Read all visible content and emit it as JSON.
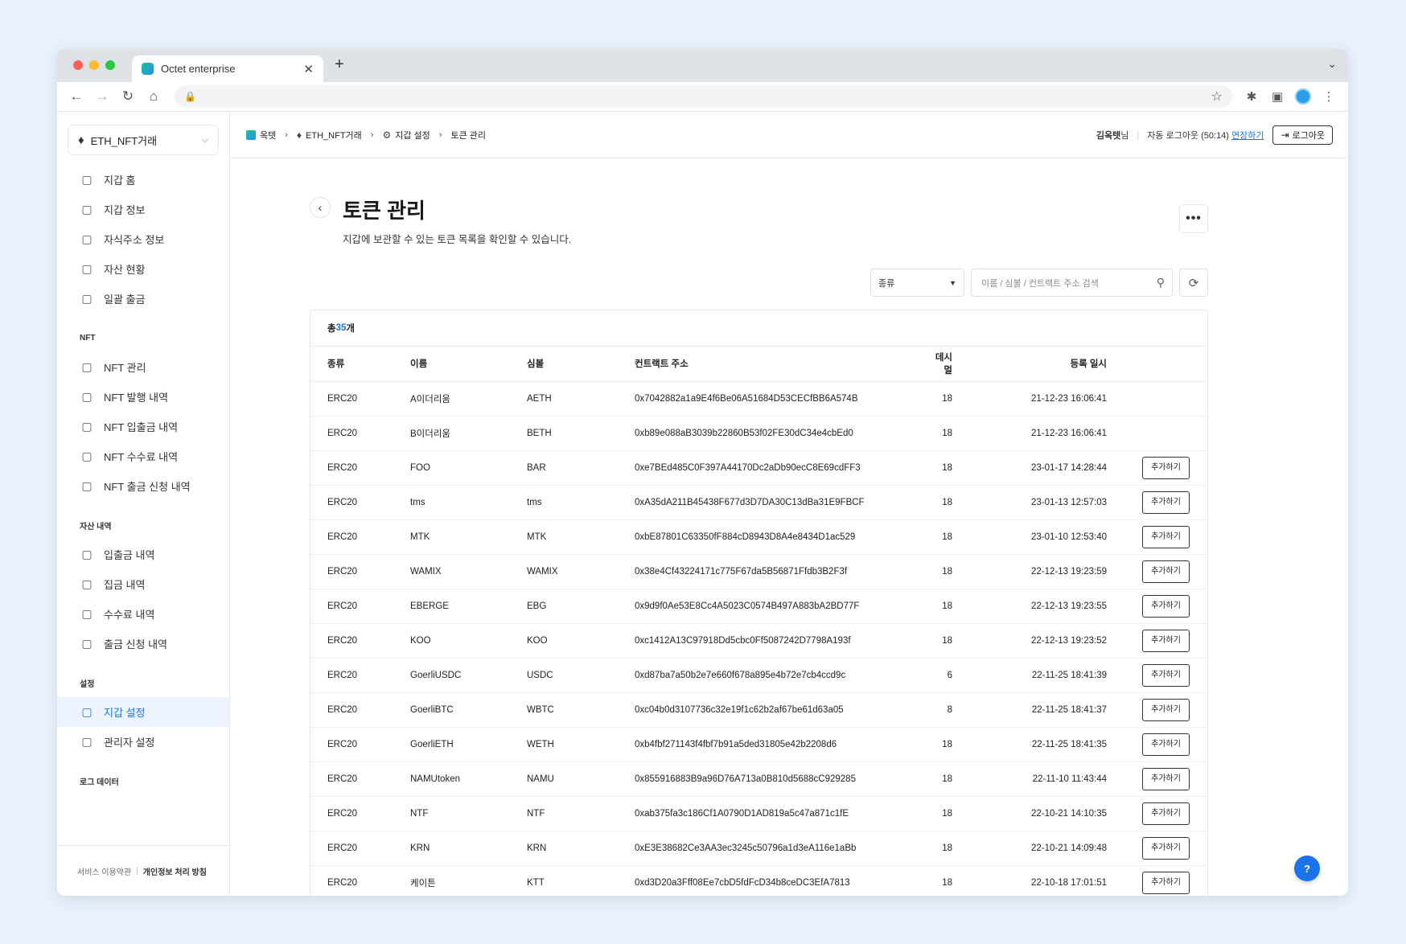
{
  "browser": {
    "tab_title": "Octet enterprise",
    "tab_close": "✕",
    "new_tab": "+"
  },
  "sidebar": {
    "wallet_selector": "ETH_NFT거래",
    "main_items": [
      {
        "label": "지갑 홈",
        "icon": "wallet-icon"
      },
      {
        "label": "지갑 정보",
        "icon": "info-doc-icon"
      },
      {
        "label": "자식주소 정보",
        "icon": "child-address-icon"
      },
      {
        "label": "자산 현황",
        "icon": "assets-icon"
      },
      {
        "label": "일괄 출금",
        "icon": "batch-withdraw-icon"
      }
    ],
    "nft_label": "NFT",
    "nft_items": [
      {
        "label": "NFT 관리",
        "icon": "nft-icon"
      },
      {
        "label": "NFT 발행 내역",
        "icon": "mint-icon"
      },
      {
        "label": "NFT 입출금 내역",
        "icon": "transfer-icon"
      },
      {
        "label": "NFT 수수료 내역",
        "icon": "fee-icon"
      },
      {
        "label": "NFT 출금 신청 내역",
        "icon": "request-icon"
      }
    ],
    "asset_label": "자산 내역",
    "asset_items": [
      {
        "label": "입출금 내역",
        "icon": "transfer-icon"
      },
      {
        "label": "집금 내역",
        "icon": "collect-icon"
      },
      {
        "label": "수수료 내역",
        "icon": "fee-icon"
      },
      {
        "label": "출금 신청 내역",
        "icon": "request-icon"
      }
    ],
    "settings_label": "설정",
    "settings_items": [
      {
        "label": "지갑 설정",
        "icon": "wallet-settings-icon",
        "active": true
      },
      {
        "label": "관리자 설정",
        "icon": "admin-icon",
        "active": false
      }
    ],
    "log_label": "로그 데이터",
    "footer": {
      "terms": "서비스 이용약관",
      "privacy": "개인정보 처리 방침"
    }
  },
  "topbar": {
    "breadcrumb": [
      "옥텟",
      "ETH_NFT거래",
      "지갑 설정",
      "토큰 관리"
    ],
    "user_name": "김옥텟",
    "user_suffix": "님",
    "auto_logout": "자동 로그아웃 (50:14)",
    "extend": "연장하기",
    "logout": "로그아웃"
  },
  "page": {
    "title": "토큰 관리",
    "description": "지갑에 보관할 수 있는 토큰 목록을 확인할 수 있습니다.",
    "more": "•••",
    "filter_type": "종류",
    "search_placeholder": "이름 / 심볼 / 컨트랙트 주소 검색",
    "total_prefix": "총 ",
    "total_count": "35",
    "total_suffix": "개"
  },
  "table": {
    "columns": [
      "종류",
      "이름",
      "심볼",
      "컨트랙트 주소",
      "데시멀",
      "등록 일시"
    ],
    "add_label": "추가하기",
    "rows": [
      {
        "type": "ERC20",
        "name": "A이더리움",
        "symbol": "AETH",
        "address": "0x7042882a1a9E4f6Be06A51684D53CECfBB6A574B",
        "decimals": "18",
        "date": "21-12-23 16:06:41",
        "addable": false
      },
      {
        "type": "ERC20",
        "name": "B이더리움",
        "symbol": "BETH",
        "address": "0xb89e088aB3039b22860B53f02FE30dC34e4cbEd0",
        "decimals": "18",
        "date": "21-12-23 16:06:41",
        "addable": false
      },
      {
        "type": "ERC20",
        "name": "FOO",
        "symbol": "BAR",
        "address": "0xe7BEd485C0F397A44170Dc2aDb90ecC8E69cdFF3",
        "decimals": "18",
        "date": "23-01-17 14:28:44",
        "addable": true
      },
      {
        "type": "ERC20",
        "name": "tms",
        "symbol": "tms",
        "address": "0xA35dA211B45438F677d3D7DA30C13dBa31E9FBCF",
        "decimals": "18",
        "date": "23-01-13 12:57:03",
        "addable": true
      },
      {
        "type": "ERC20",
        "name": "MTK",
        "symbol": "MTK",
        "address": "0xbE87801C63350fF884cD8943D8A4e8434D1ac529",
        "decimals": "18",
        "date": "23-01-10 12:53:40",
        "addable": true
      },
      {
        "type": "ERC20",
        "name": "WAMIX",
        "symbol": "WAMIX",
        "address": "0x38e4Cf43224171c775F67da5B56871Ffdb3B2F3f",
        "decimals": "18",
        "date": "22-12-13 19:23:59",
        "addable": true
      },
      {
        "type": "ERC20",
        "name": "EBERGE",
        "symbol": "EBG",
        "address": "0x9d9f0Ae53E8Cc4A5023C0574B497A883bA2BD77F",
        "decimals": "18",
        "date": "22-12-13 19:23:55",
        "addable": true
      },
      {
        "type": "ERC20",
        "name": "KOO",
        "symbol": "KOO",
        "address": "0xc1412A13C97918Dd5cbc0Ff5087242D7798A193f",
        "decimals": "18",
        "date": "22-12-13 19:23:52",
        "addable": true
      },
      {
        "type": "ERC20",
        "name": "GoerliUSDC",
        "symbol": "USDC",
        "address": "0xd87ba7a50b2e7e660f678a895e4b72e7cb4ccd9c",
        "decimals": "6",
        "date": "22-11-25 18:41:39",
        "addable": true
      },
      {
        "type": "ERC20",
        "name": "GoerliBTC",
        "symbol": "WBTC",
        "address": "0xc04b0d3107736c32e19f1c62b2af67be61d63a05",
        "decimals": "8",
        "date": "22-11-25 18:41:37",
        "addable": true
      },
      {
        "type": "ERC20",
        "name": "GoerliETH",
        "symbol": "WETH",
        "address": "0xb4fbf271143f4fbf7b91a5ded31805e42b2208d6",
        "decimals": "18",
        "date": "22-11-25 18:41:35",
        "addable": true
      },
      {
        "type": "ERC20",
        "name": "NAMUtoken",
        "symbol": "NAMU",
        "address": "0x855916883B9a96D76A713a0B810d5688cC929285",
        "decimals": "18",
        "date": "22-11-10 11:43:44",
        "addable": true
      },
      {
        "type": "ERC20",
        "name": "NTF",
        "symbol": "NTF",
        "address": "0xab375fa3c186Cf1A0790D1AD819a5c47a871c1fE",
        "decimals": "18",
        "date": "22-10-21 14:10:35",
        "addable": true
      },
      {
        "type": "ERC20",
        "name": "KRN",
        "symbol": "KRN",
        "address": "0xE3E38682Ce3AA3ec3245c50796a1d3eA116e1aBb",
        "decimals": "18",
        "date": "22-10-21 14:09:48",
        "addable": true
      },
      {
        "type": "ERC20",
        "name": "케이튼",
        "symbol": "KTT",
        "address": "0xd3D20a3Fff08Ee7cbD5fdFcD34b8ceDC3EfA7813",
        "decimals": "18",
        "date": "22-10-18 17:01:51",
        "addable": true
      }
    ]
  },
  "help": "?",
  "colors": {
    "accent": "#1a73e8",
    "active_bg": "#eef4fd",
    "page_bg": "#e9f1fb"
  }
}
